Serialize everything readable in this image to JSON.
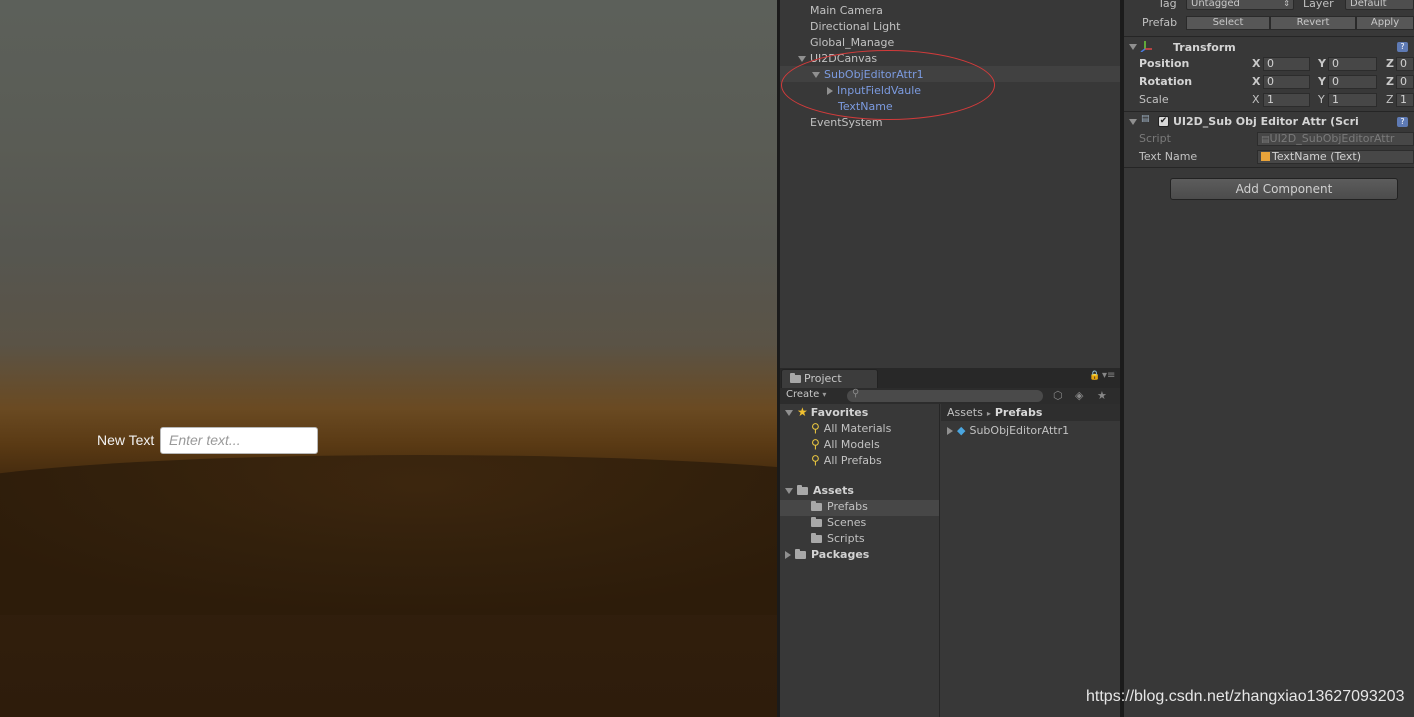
{
  "game": {
    "label": "New Text",
    "input_placeholder": "Enter text..."
  },
  "hierarchy": {
    "items": [
      {
        "label": "Main Camera"
      },
      {
        "label": "Directional Light"
      },
      {
        "label": "Global_Manage"
      },
      {
        "label": "UI2DCanvas"
      },
      {
        "label": "SubObjEditorAttr1"
      },
      {
        "label": "InputFieldVaule"
      },
      {
        "label": "TextName"
      },
      {
        "label": "EventSystem"
      }
    ]
  },
  "project": {
    "tab": "Project",
    "create": "Create",
    "favorites": {
      "label": "Favorites",
      "items": [
        "All Materials",
        "All Models",
        "All Prefabs"
      ]
    },
    "assets": {
      "label": "Assets",
      "items": [
        "Prefabs",
        "Scenes",
        "Scripts"
      ]
    },
    "packages": "Packages",
    "breadcrumb": [
      "Assets",
      "Prefabs"
    ],
    "files": [
      "SubObjEditorAttr1"
    ]
  },
  "inspector": {
    "tag_label": "Tag",
    "tag_value": "Untagged",
    "layer_label": "Layer",
    "layer_value": "Default",
    "prefab_label": "Prefab",
    "prefab_buttons": [
      "Select",
      "Revert",
      "Apply"
    ],
    "transform": {
      "title": "Transform",
      "rows": [
        {
          "label": "Position",
          "x": "0",
          "y": "0",
          "z": "0"
        },
        {
          "label": "Rotation",
          "x": "0",
          "y": "0",
          "z": "0"
        },
        {
          "label": "Scale",
          "x": "1",
          "y": "1",
          "z": "1"
        }
      ],
      "axes": [
        "X",
        "Y",
        "Z"
      ]
    },
    "script_component": {
      "title": "UI2D_Sub Obj Editor Attr (Scri",
      "script_label": "Script",
      "script_value": "UI2D_SubObjEditorAttr",
      "textname_label": "Text Name",
      "textname_value": "TextName (Text)"
    },
    "add_component": "Add Component"
  },
  "watermark": "https://blog.csdn.net/zhangxiao13627093203",
  "colors": {
    "selection_blue": "#7c9be0",
    "annotation_red": "#d23b3b"
  }
}
